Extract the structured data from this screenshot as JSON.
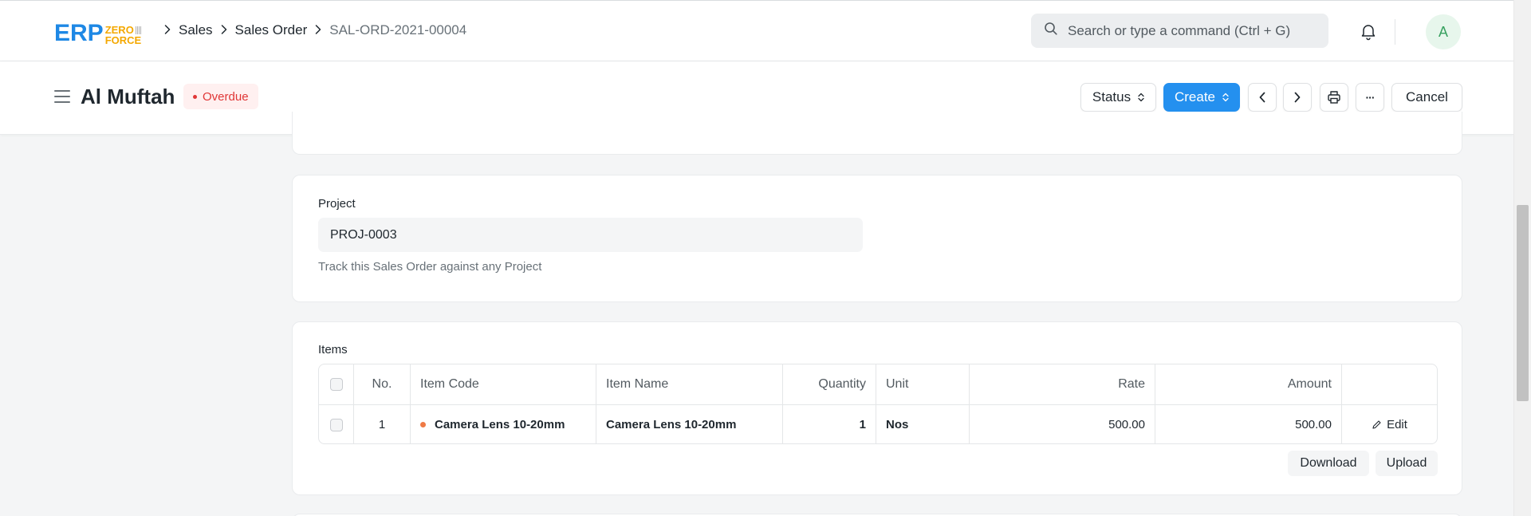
{
  "app": {
    "logo_main": "ERP",
    "logo_top": "ZERO",
    "logo_bottom": "FORCE"
  },
  "breadcrumb": {
    "items": [
      "Sales",
      "Sales Order"
    ],
    "current": "SAL-ORD-2021-00004"
  },
  "search": {
    "placeholder": "Search or type a command (Ctrl + G)"
  },
  "user": {
    "avatar_initial": "A"
  },
  "page": {
    "title": "Al Muftah",
    "status": "Overdue",
    "status_color": "#e03636"
  },
  "toolbar": {
    "status_label": "Status",
    "create_label": "Create",
    "cancel_label": "Cancel",
    "more_label": "···"
  },
  "project": {
    "label": "Project",
    "value": "PROJ-0003",
    "description": "Track this Sales Order against any Project"
  },
  "items": {
    "label": "Items",
    "columns": [
      "No.",
      "Item Code",
      "Item Name",
      "Quantity",
      "Unit",
      "Rate",
      "Amount"
    ],
    "rows": [
      {
        "no": "1",
        "item_code": "Camera Lens 10-20mm",
        "item_name": "Camera Lens 10-20mm",
        "quantity": "1",
        "unit": "Nos",
        "rate": "500.00",
        "amount": "500.00",
        "edit_label": "Edit"
      }
    ],
    "download_label": "Download",
    "upload_label": "Upload"
  },
  "colors": {
    "primary": "#2490ef",
    "logo_blue": "#1e88e5",
    "logo_orange": "#f4a800",
    "item_dot": "#ef7a45"
  }
}
